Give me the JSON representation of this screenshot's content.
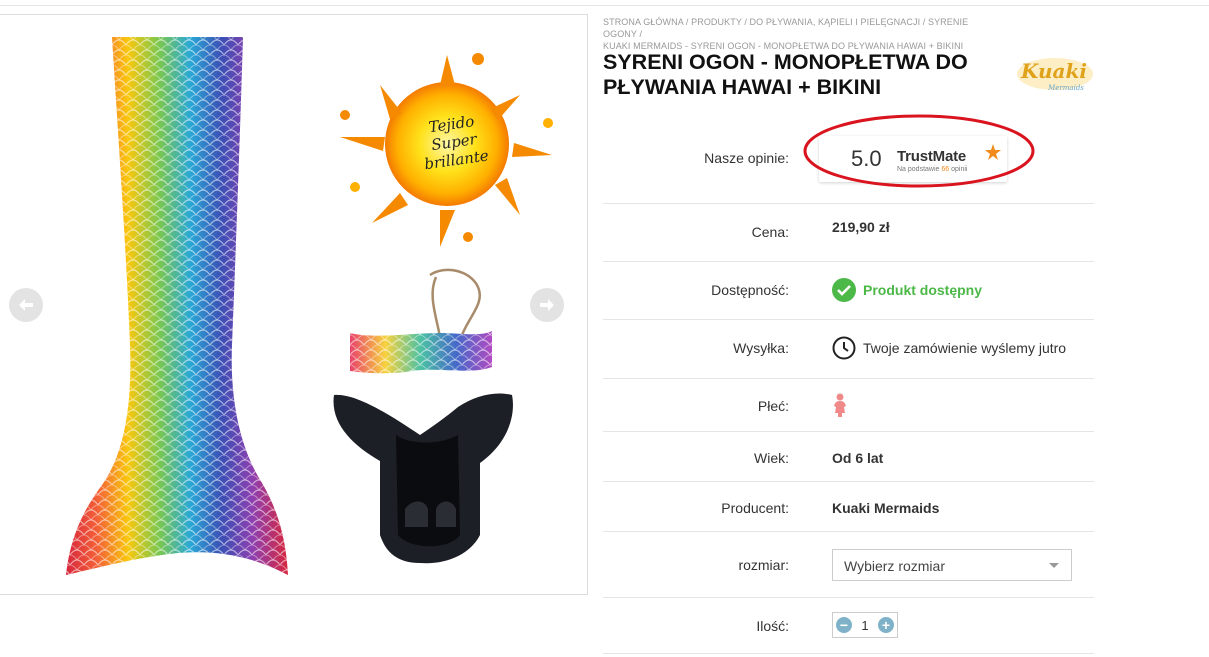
{
  "breadcrumb": {
    "line1": "STRONA GŁÓWNA / PRODUKTY / DO PŁYWANIA, KĄPIELI I PIELĘGNACJI / SYRENIE OGONY /",
    "line2": "KUAKI MERMAIDS - SYRENI OGON - MONOPŁETWA DO PŁYWANIA HAWAI + BIKINI"
  },
  "product": {
    "title": "SYRENI OGON - MONOPŁETWA DO PŁYWANIA HAWAI + BIKINI",
    "brand_logo_text": "Kuaki",
    "brand_logo_sub": "Mermaids"
  },
  "gallery": {
    "splash_text_line1": "Tejido",
    "splash_text_line2": "Super brillante"
  },
  "reviews": {
    "label": "Nasze opinie:",
    "score": "5.0",
    "provider": "TrustMate",
    "sub_prefix": "Na podstawie",
    "count": "66",
    "sub_suffix": "opinii",
    "star_color": "#f28a1c",
    "highlight_color": "#d9141e"
  },
  "price": {
    "label": "Cena:",
    "value": "219,90 zł"
  },
  "availability": {
    "label": "Dostępność:",
    "value": "Produkt dostępny",
    "color": "#4cb848"
  },
  "shipping": {
    "label": "Wysyłka:",
    "value": "Twoje zamówienie wyślemy jutro"
  },
  "gender": {
    "label": "Płeć:",
    "icon": "girl-icon"
  },
  "age": {
    "label": "Wiek:",
    "value": "Od 6 lat"
  },
  "producer": {
    "label": "Producent:",
    "value": "Kuaki Mermaids"
  },
  "size": {
    "label": "rozmiar:",
    "selected": "Wybierz rozmiar"
  },
  "quantity": {
    "label": "Ilość:",
    "value": "1",
    "minus": "−",
    "plus": "+"
  }
}
